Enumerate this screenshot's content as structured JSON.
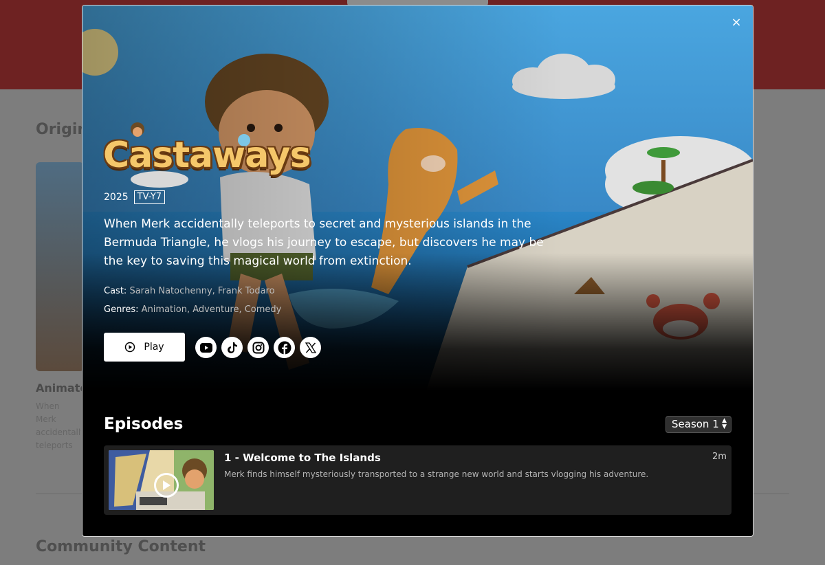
{
  "background_page": {
    "section_title": "Originals",
    "card_title": "Animated",
    "card_desc": "When Merk accidentally teleports to secret and mysterious islands in the Bermuda Triangle",
    "community_title": "Community Content"
  },
  "modal": {
    "close_label": "×",
    "show": {
      "title": "Castaways",
      "year": "2025",
      "rating": "TV-Y7",
      "description": "When Merk accidentally teleports to secret and mysterious islands in the Bermuda Triangle, he vlogs his journey to escape, but discovers he may be the key to saving this magical world from extinction.",
      "cast_label": "Cast:",
      "cast": "Sarah Natochenny, Frank Todaro",
      "genres_label": "Genres:",
      "genres": "Animation, Adventure, Comedy"
    },
    "play_label": "Play",
    "socials": [
      {
        "name": "youtube",
        "icon": "youtube-icon"
      },
      {
        "name": "tiktok",
        "icon": "tiktok-icon"
      },
      {
        "name": "instagram",
        "icon": "instagram-icon"
      },
      {
        "name": "facebook",
        "icon": "facebook-icon"
      },
      {
        "name": "x",
        "icon": "x-icon"
      }
    ],
    "episodes": {
      "title": "Episodes",
      "season_selected": "Season 1",
      "items": [
        {
          "title": "1 - Welcome to The Islands",
          "description": "Merk finds himself mysteriously transported to a strange new world and starts vlogging his adventure.",
          "duration": "2m"
        }
      ]
    }
  },
  "colors": {
    "header_red": "#6e2222",
    "modal_bg": "#000000",
    "episode_row_bg": "#1f1f1f",
    "logo_gold": "#f5c76a"
  }
}
